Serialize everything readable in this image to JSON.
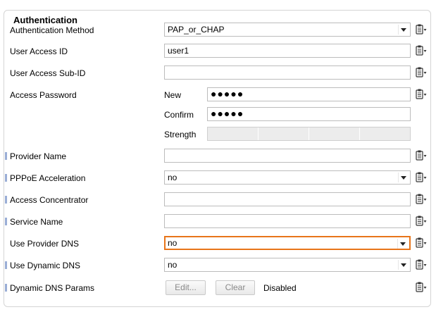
{
  "section": {
    "title": "Authentication"
  },
  "fields": {
    "auth_method": {
      "label": "Authentication Method",
      "value": "PAP_or_CHAP"
    },
    "user_access_id": {
      "label": "User Access ID",
      "value": "user1"
    },
    "user_access_sub_id": {
      "label": "User Access Sub-ID",
      "value": ""
    },
    "access_password": {
      "label": "Access Password",
      "new_label": "New",
      "new_value": "●●●●●",
      "confirm_label": "Confirm",
      "confirm_value": "●●●●●",
      "strength_label": "Strength"
    },
    "provider_name": {
      "label": "Provider Name",
      "value": ""
    },
    "pppoe_acceleration": {
      "label": "PPPoE Acceleration",
      "value": "no"
    },
    "access_concentrator": {
      "label": "Access Concentrator",
      "value": ""
    },
    "service_name": {
      "label": "Service Name",
      "value": ""
    },
    "use_provider_dns": {
      "label": "Use Provider DNS",
      "value": "no"
    },
    "use_dynamic_dns": {
      "label": "Use Dynamic DNS",
      "value": "no"
    },
    "dynamic_dns_params": {
      "label": "Dynamic DNS Params",
      "edit_label": "Edit...",
      "clear_label": "Clear",
      "status": "Disabled"
    }
  },
  "colors": {
    "focus_border": "#e8751a",
    "marker": "#9aaed6"
  },
  "icons": {
    "row_menu": "clipboard-menu-icon"
  }
}
